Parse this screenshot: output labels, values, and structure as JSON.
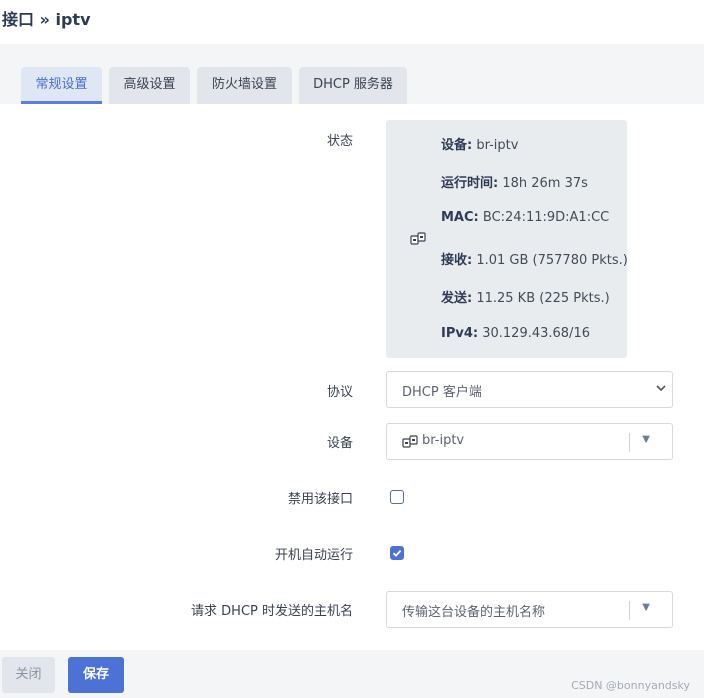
{
  "page": {
    "title": "接口 » iptv"
  },
  "tabs": [
    {
      "label": "常规设置",
      "active": true
    },
    {
      "label": "高级设置",
      "active": false
    },
    {
      "label": "防火墙设置",
      "active": false
    },
    {
      "label": "DHCP 服务器",
      "active": false
    }
  ],
  "status": {
    "label": "状态",
    "icon": "network-interface-icon",
    "rows": [
      {
        "key": "设备:",
        "value": " br-iptv"
      },
      {
        "key": "运行时间:",
        "value": " 18h 26m 37s"
      },
      {
        "key": "MAC:",
        "value": " BC:24:11:9D:A1:CC"
      },
      {
        "key": "接收:",
        "value": " 1.01 GB (757780 Pkts.)"
      },
      {
        "key": "发送:",
        "value": " 11.25 KB (225 Pkts.)"
      },
      {
        "key": "IPv4:",
        "value": " 30.129.43.68/16"
      }
    ]
  },
  "protocol": {
    "label": "协议",
    "value": "DHCP 客户端"
  },
  "device": {
    "label": "设备",
    "value": "br-iptv",
    "icon": "network-interface-icon"
  },
  "disable_interface": {
    "label": "禁用该接口",
    "checked": false
  },
  "auto_start": {
    "label": "开机自动运行",
    "checked": true
  },
  "hostname": {
    "label": "请求 DHCP 时发送的主机名",
    "placeholder": "传输这台设备的主机名称"
  },
  "buttons": {
    "close": "关闭",
    "save": "保存"
  },
  "watermark": "CSDN @bonnyandsky",
  "colors": {
    "accent": "#4d72d6",
    "panel": "#ffffff",
    "background": "#f4f5f7"
  }
}
